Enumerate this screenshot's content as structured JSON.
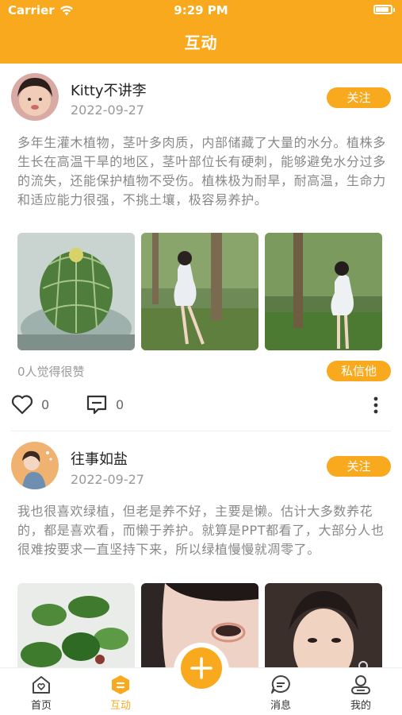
{
  "status_bar": {
    "carrier": "Carrier",
    "time": "9:29 PM"
  },
  "header": {
    "title": "互动"
  },
  "posts": [
    {
      "username": "Kitty不讲李",
      "date": "2022-09-27",
      "follow_label": "关注",
      "text": "多年生灌木植物，茎叶多肉质，内部储藏了大量的水分。植株多生长在高温干旱的地区，茎叶部位长有硬刺，能够避免水分过多的流失，还能保护植物不受伤。植株极为耐旱，耐高温，生命力和适应能力很强，不挑土壤，极容易养护。",
      "likes_text": "0人觉得很赞",
      "chat_label": "私信他",
      "like_count": "0",
      "comment_count": "0"
    },
    {
      "username": "往事如盐",
      "date": "2022-09-27",
      "follow_label": "关注",
      "text": "我也很喜欢绿植，但老是养不好，主要是懒。估计大多数养花的，都是喜欢看，而懒于养护。就算是PPT都看了，大部分人也很难按要求一直坚持下来，所以绿植慢慢就凋零了。"
    }
  ],
  "tabbar": {
    "items": [
      {
        "label": "首页",
        "icon": "home-icon"
      },
      {
        "label": "互动",
        "icon": "interact-icon",
        "active": true
      },
      {
        "label": "消息",
        "icon": "message-icon"
      },
      {
        "label": "我的",
        "icon": "profile-icon"
      }
    ],
    "fab_icon": "plus-icon"
  },
  "colors": {
    "accent": "#f9a91e",
    "muted_text": "#888888"
  }
}
